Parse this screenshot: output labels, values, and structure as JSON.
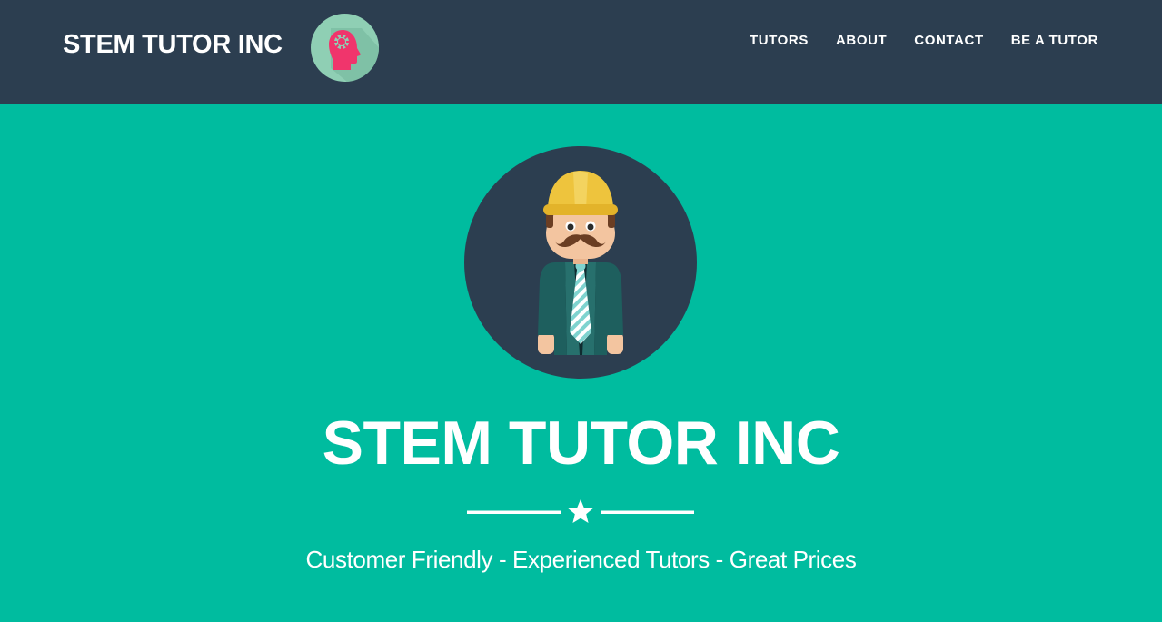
{
  "nav": {
    "brand": "STEM TUTOR INC",
    "brand_logo_icon": "brain-head-icon",
    "links": [
      {
        "label": "TUTORS"
      },
      {
        "label": "ABOUT"
      },
      {
        "label": "CONTACT"
      },
      {
        "label": "BE A TUTOR"
      }
    ]
  },
  "hero": {
    "avatar_icon": "tutor-avatar-icon",
    "title": "STEM TUTOR INC",
    "divider_icon": "star-icon",
    "tagline": "Customer Friendly - Experienced Tutors - Great Prices"
  },
  "colors": {
    "navbar_bg": "#2c3e50",
    "hero_bg": "#00bc9f",
    "logo_bg": "#8fcfb4",
    "logo_accent": "#f0356c",
    "text": "#ffffff"
  }
}
